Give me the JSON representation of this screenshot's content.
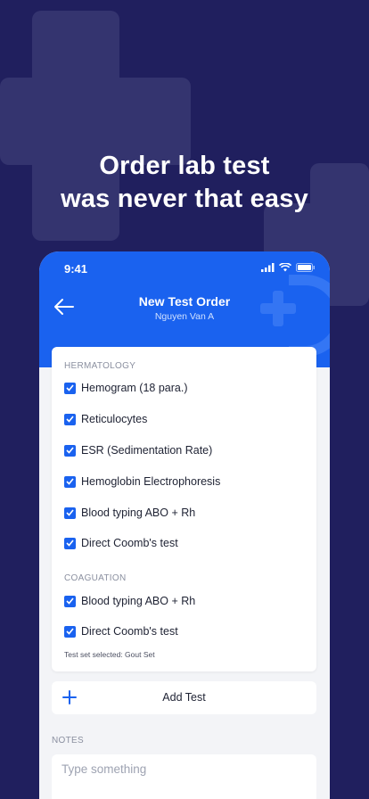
{
  "headline": {
    "line1": "Order lab test",
    "line2": "was never that easy"
  },
  "status_bar": {
    "time": "9:41"
  },
  "header": {
    "title": "New Test Order",
    "subtitle": "Nguyen Van A"
  },
  "sections": [
    {
      "label": "HERMATOLOGY",
      "items": [
        "Hemogram (18 para.)",
        "Reticulocytes",
        "ESR (Sedimentation Rate)",
        "Hemoglobin Electrophoresis",
        "Blood typing ABO + Rh",
        "Direct Coomb's test"
      ]
    },
    {
      "label": "COAGUATION",
      "items": [
        "Blood typing ABO + Rh",
        "Direct Coomb's test"
      ]
    }
  ],
  "test_set_text": "Test set selected: Gout Set",
  "add_test_label": "Add Test",
  "notes": {
    "label": "NOTES",
    "placeholder": "Type something"
  },
  "colors": {
    "background": "#201f5e",
    "accent": "#1a62ef"
  },
  "icons": [
    "back-arrow-icon",
    "checkbox-checked-icon",
    "plus-icon",
    "signal-icon",
    "wifi-icon",
    "battery-icon",
    "logo-icon"
  ]
}
